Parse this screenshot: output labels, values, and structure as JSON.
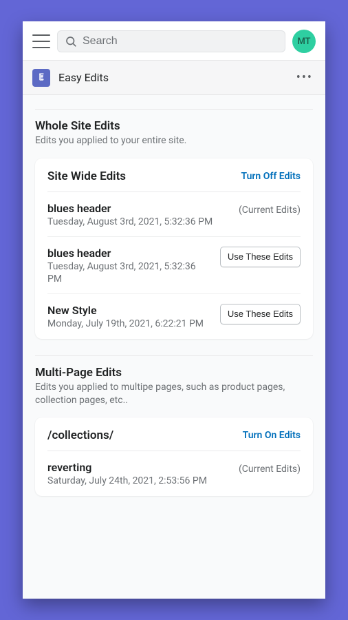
{
  "header": {
    "search_placeholder": "Search",
    "avatar_initials": "MT"
  },
  "appbar": {
    "title": "Easy Edits"
  },
  "sections": {
    "wholeSite": {
      "title": "Whole Site Edits",
      "subtitle": "Edits you applied to your entire site.",
      "card_title": "Site Wide Edits",
      "toggle_label": "Turn Off Edits",
      "current_label": "(Current Edits)",
      "use_label": "Use These Edits",
      "edits": [
        {
          "name": "blues header",
          "date": "Tuesday, August 3rd, 2021, 5:32:36 PM",
          "current": true
        },
        {
          "name": "blues header",
          "date": "Tuesday, August 3rd, 2021, 5:32:36 PM",
          "current": false
        },
        {
          "name": "New Style",
          "date": "Monday, July 19th, 2021, 6:22:21 PM",
          "current": false
        }
      ]
    },
    "multiPage": {
      "title": "Multi-Page Edits",
      "subtitle": "Edits you applied to multipe pages, such as product pages, collection pages, etc..",
      "card_title": "/collections/",
      "toggle_label": "Turn On Edits",
      "current_label": "(Current Edits)",
      "edits": [
        {
          "name": "reverting",
          "date": "Saturday, July 24th, 2021, 2:53:56 PM",
          "current": true
        }
      ]
    }
  }
}
